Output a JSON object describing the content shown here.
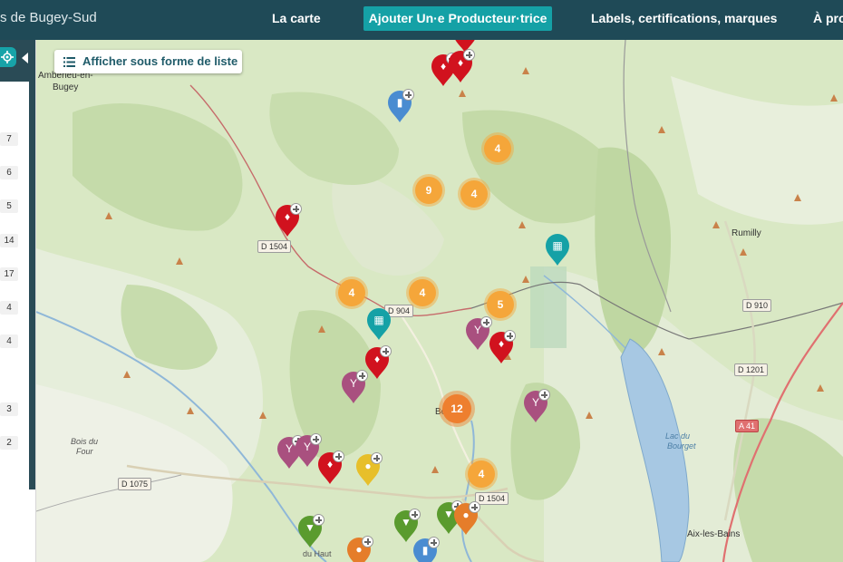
{
  "header": {
    "site_title": "s de Bugey-Sud",
    "nav": [
      {
        "label": "La carte"
      },
      {
        "label": "Ajouter Un·e Producteur·trice"
      },
      {
        "label": "Labels, certifications, marques"
      },
      {
        "label": "À pro"
      }
    ]
  },
  "sidebar": {
    "counts": [
      "7",
      "6",
      "5",
      "14",
      "17",
      "4",
      "4",
      "3",
      "2"
    ]
  },
  "map": {
    "list_button_label": "Afficher sous forme de liste",
    "clusters": [
      "4",
      "9",
      "4",
      "4",
      "4",
      "5",
      "12",
      "4"
    ],
    "place_labels": {
      "amberieu": "Ambérieu-en-",
      "bugey": "Bugey",
      "rumilly": "Rumilly",
      "aix": "Aix-les-Bains",
      "bois_du_four_1": "Bois du",
      "bois_du_four_2": "Four",
      "lac_1": "Lac du",
      "lac_2": "Bourget",
      "be": "Be",
      "haut": "du Haut"
    },
    "road_labels": {
      "d1504_a": "D 1504",
      "d904": "D 904",
      "d910": "D 910",
      "d1201": "D 1201",
      "a41": "A 41",
      "d1075": "D 1075",
      "d1504_b": "D 1504"
    },
    "pin_types": {
      "red": "cow-icon",
      "blue": "milk-bottle-icon",
      "teal": "basket-icon",
      "purple": "wine-glass-icon",
      "yellow": "honey-icon",
      "green": "carrot-icon",
      "orange": "apple-icon"
    },
    "colors": {
      "header": "#1f4a57",
      "accent": "#15a1a6",
      "cluster": "#f5a63a",
      "red_pin": "#d1121e",
      "purple_pin": "#a9507f",
      "teal_pin": "#15a1a6",
      "blue_pin": "#4a8cd1",
      "yellow_pin": "#e7bf2a",
      "green_pin": "#5a9b2e",
      "orange_pin": "#e57d2a"
    }
  }
}
